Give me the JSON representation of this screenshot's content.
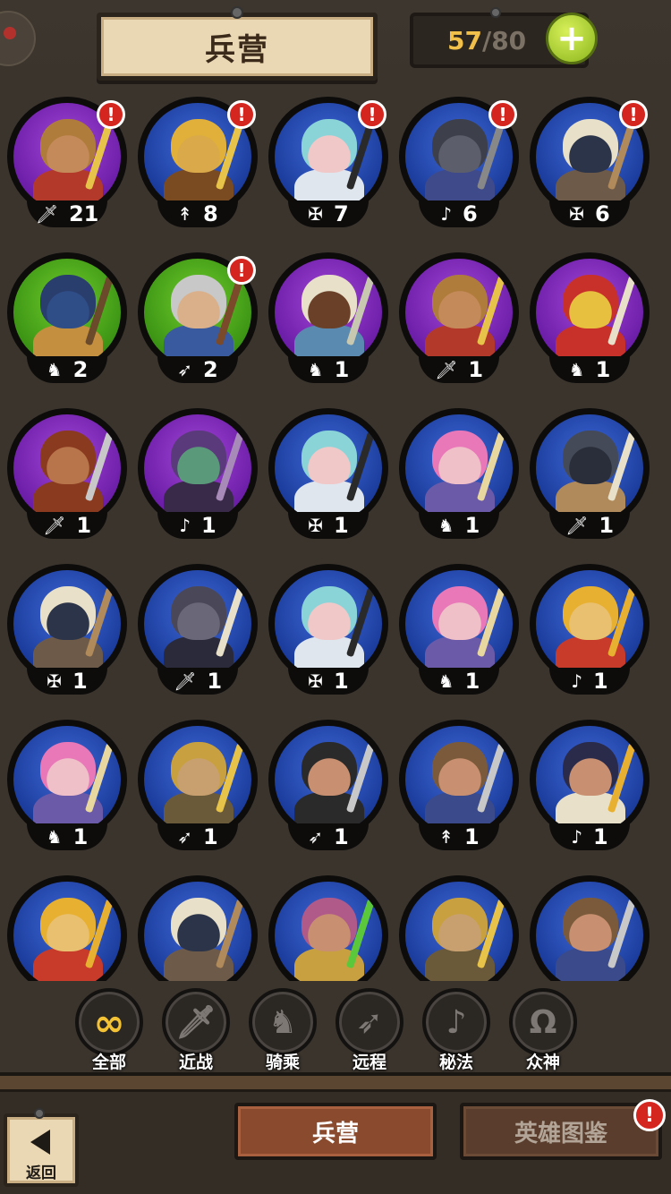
{
  "header": {
    "title": "兵营",
    "count_current": "57",
    "count_separator": "/",
    "count_max": "80",
    "plus_label": "+"
  },
  "colors": {
    "blue": "#1b3c9c",
    "purple": "#6c1ea8",
    "green": "#3c9414",
    "alert": "#d5251f",
    "accent_yellow": "#f4c235"
  },
  "icons": {
    "melee": "🗡",
    "ride": "♞",
    "ranged": "➶",
    "magic": "♪",
    "divine": "Ω",
    "all": "∞"
  },
  "units": [
    {
      "rarity": "purple",
      "class_icon": "🗡",
      "class": "melee",
      "count": "21",
      "alert": true,
      "skin": "#c58a5a",
      "hair": "#b07c3c",
      "armor": "#b33a2a",
      "weapon": "#e8c34a"
    },
    {
      "rarity": "blue",
      "class_icon": "↟",
      "class": "spear",
      "count": "8",
      "alert": true,
      "skin": "#d9a94a",
      "hair": "#e0b03a",
      "armor": "#7a4a20",
      "weapon": "#e8c34a"
    },
    {
      "rarity": "blue",
      "class_icon": "✠",
      "class": "ice",
      "count": "7",
      "alert": true,
      "skin": "#f0c8c8",
      "hair": "#8ad4d8",
      "armor": "#dfe6ee",
      "weapon": "#2a2a2a"
    },
    {
      "rarity": "blue",
      "class_icon": "♪",
      "class": "magic",
      "count": "6",
      "alert": true,
      "skin": "#5c5f6b",
      "hair": "#3d404b",
      "armor": "#3f4a8a",
      "weapon": "#888"
    },
    {
      "rarity": "blue",
      "class_icon": "✠",
      "class": "ice",
      "count": "6",
      "alert": true,
      "skin": "#2b3448",
      "hair": "#e8e0c8",
      "armor": "#6e5a48",
      "weapon": "#b08a5a"
    },
    {
      "rarity": "green",
      "class_icon": "♞",
      "class": "ride",
      "count": "2",
      "alert": false,
      "skin": "#2f4e88",
      "hair": "#2a3e6e",
      "armor": "#c49040",
      "weapon": "#6a4a2a"
    },
    {
      "rarity": "green",
      "class_icon": "➶",
      "class": "ranged",
      "count": "2",
      "alert": true,
      "skin": "#d9b08a",
      "hair": "#c8c8c8",
      "armor": "#3a5aa0",
      "weapon": "#7a4a2a"
    },
    {
      "rarity": "purple",
      "class_icon": "♞",
      "class": "ride",
      "count": "1",
      "alert": false,
      "skin": "#6a4028",
      "hair": "#e8e0c8",
      "armor": "#5a8ab0",
      "weapon": "#c8c8b0"
    },
    {
      "rarity": "purple",
      "class_icon": "🗡",
      "class": "melee",
      "count": "1",
      "alert": false,
      "skin": "#c58a5a",
      "hair": "#b07c3c",
      "armor": "#b33a2a",
      "weapon": "#e8c34a"
    },
    {
      "rarity": "purple",
      "class_icon": "♞",
      "class": "ride",
      "count": "1",
      "alert": false,
      "skin": "#e8c040",
      "hair": "#c8302a",
      "armor": "#c8302a",
      "weapon": "#e8e0c8"
    },
    {
      "rarity": "purple",
      "class_icon": "🗡",
      "class": "melee",
      "count": "1",
      "alert": false,
      "skin": "#b8744a",
      "hair": "#8a3a1e",
      "armor": "#8a3a1e",
      "weapon": "#c8c8c8"
    },
    {
      "rarity": "purple",
      "class_icon": "♪",
      "class": "magic",
      "count": "1",
      "alert": false,
      "skin": "#5a9a7a",
      "hair": "#5a3a7a",
      "armor": "#3a2a4a",
      "weapon": "#a88ab8"
    },
    {
      "rarity": "blue",
      "class_icon": "✠",
      "class": "ice",
      "count": "1",
      "alert": false,
      "skin": "#f0c8c8",
      "hair": "#8ad4d8",
      "armor": "#dfe6ee",
      "weapon": "#2a2a2a"
    },
    {
      "rarity": "blue",
      "class_icon": "♞",
      "class": "ride",
      "count": "1",
      "alert": false,
      "skin": "#f0c0c8",
      "hair": "#e878b8",
      "armor": "#6a5aa8",
      "weapon": "#e8d8a0"
    },
    {
      "rarity": "blue",
      "class_icon": "🗡",
      "class": "melee",
      "count": "1",
      "alert": false,
      "skin": "#2a2e3a",
      "hair": "#444a58",
      "armor": "#b08a5a",
      "weapon": "#e8e0c8"
    },
    {
      "rarity": "blue",
      "class_icon": "✠",
      "class": "ice",
      "count": "1",
      "alert": false,
      "skin": "#2b3448",
      "hair": "#e8e0c8",
      "armor": "#6e5a48",
      "weapon": "#b08a5a"
    },
    {
      "rarity": "blue",
      "class_icon": "🗡",
      "class": "melee",
      "count": "1",
      "alert": false,
      "skin": "#6a6878",
      "hair": "#4a4858",
      "armor": "#2a2a3a",
      "weapon": "#e8e0c8"
    },
    {
      "rarity": "blue",
      "class_icon": "✠",
      "class": "ice",
      "count": "1",
      "alert": false,
      "skin": "#f0c8c8",
      "hair": "#8ad4d8",
      "armor": "#dfe6ee",
      "weapon": "#2a2a2a"
    },
    {
      "rarity": "blue",
      "class_icon": "♞",
      "class": "ride",
      "count": "1",
      "alert": false,
      "skin": "#f0c0c8",
      "hair": "#e878b8",
      "armor": "#6a5aa8",
      "weapon": "#e8d8a0"
    },
    {
      "rarity": "blue",
      "class_icon": "♪",
      "class": "magic",
      "count": "1",
      "alert": false,
      "skin": "#e8c070",
      "hair": "#e8b030",
      "armor": "#c83a2a",
      "weapon": "#e8b030"
    },
    {
      "rarity": "blue",
      "class_icon": "♞",
      "class": "ride",
      "count": "1",
      "alert": false,
      "skin": "#f0c0c8",
      "hair": "#e878b8",
      "armor": "#6a5aa8",
      "weapon": "#e8d8a0"
    },
    {
      "rarity": "blue",
      "class_icon": "➶",
      "class": "ranged",
      "count": "1",
      "alert": false,
      "skin": "#c8a070",
      "hair": "#c8a040",
      "armor": "#6a5a3a",
      "weapon": "#e8c34a"
    },
    {
      "rarity": "blue",
      "class_icon": "➶",
      "class": "ranged",
      "count": "1",
      "alert": false,
      "skin": "#c89070",
      "hair": "#2a2a2a",
      "armor": "#2a2a2a",
      "weapon": "#c8c8c8"
    },
    {
      "rarity": "blue",
      "class_icon": "↟",
      "class": "spear",
      "count": "1",
      "alert": false,
      "skin": "#c89070",
      "hair": "#7a5a3a",
      "armor": "#3a4a8a",
      "weapon": "#c8c8c8"
    },
    {
      "rarity": "blue",
      "class_icon": "♪",
      "class": "magic",
      "count": "1",
      "alert": false,
      "skin": "#c89070",
      "hair": "#2a2a4a",
      "armor": "#e8e0c8",
      "weapon": "#e8b030"
    },
    {
      "rarity": "blue",
      "class_icon": "",
      "class": "magic",
      "count": "",
      "alert": false,
      "skin": "#e8c070",
      "hair": "#e8b030",
      "armor": "#c83a2a",
      "weapon": "#e8b030"
    },
    {
      "rarity": "blue",
      "class_icon": "",
      "class": "ice",
      "count": "",
      "alert": false,
      "skin": "#2b3448",
      "hair": "#e8e0c8",
      "armor": "#6e5a48",
      "weapon": "#b08a5a"
    },
    {
      "rarity": "blue",
      "class_icon": "",
      "class": "magic",
      "count": "",
      "alert": false,
      "skin": "#c89070",
      "hair": "#b05a8a",
      "armor": "#c8a040",
      "weapon": "#5ac83a"
    },
    {
      "rarity": "blue",
      "class_icon": "",
      "class": "ranged",
      "count": "",
      "alert": false,
      "skin": "#c8a070",
      "hair": "#c8a040",
      "armor": "#6a5a3a",
      "weapon": "#e8c34a"
    },
    {
      "rarity": "blue",
      "class_icon": "",
      "class": "spear",
      "count": "",
      "alert": false,
      "skin": "#c89070",
      "hair": "#7a5a3a",
      "armor": "#3a4a8a",
      "weapon": "#c8c8c8"
    }
  ],
  "filters": [
    {
      "label": "全部",
      "icon": "∞",
      "active": true
    },
    {
      "label": "近战",
      "icon": "🗡",
      "active": false
    },
    {
      "label": "骑乘",
      "icon": "♞",
      "active": false
    },
    {
      "label": "远程",
      "icon": "➶",
      "active": false
    },
    {
      "label": "秘法",
      "icon": "♪",
      "active": false
    },
    {
      "label": "众神",
      "icon": "Ω",
      "active": false
    }
  ],
  "bottom": {
    "tab_barracks": "兵营",
    "tab_heroes": "英雄图鉴",
    "tab_alert": "!",
    "back_label": "返回"
  }
}
